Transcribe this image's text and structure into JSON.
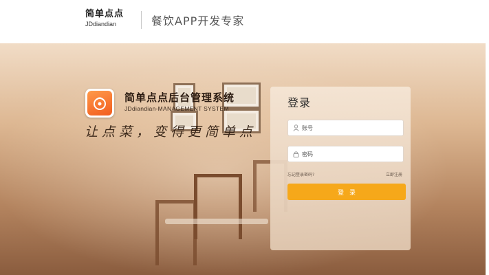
{
  "header": {
    "brand_cn": "简单点点",
    "brand_en": "JDdiandian",
    "tagline": "餐饮APP开发专家"
  },
  "system": {
    "title": "简单点点后台管理系统",
    "subtitle": "JDdiandian-MANAGEMENT SYSTEM",
    "slogan": "让点菜，变得更简单点"
  },
  "login": {
    "title": "登录",
    "username_placeholder": "账号",
    "password_placeholder": "密码",
    "link_left": "忘记登录密码?",
    "link_right": "立即注册",
    "button_label": "登录"
  },
  "colors": {
    "accent": "#f6a81a",
    "logo_orange": "#f25c1e"
  },
  "icons": {
    "user": "user-icon",
    "lock": "lock-icon",
    "logo": "app-logo-icon"
  }
}
